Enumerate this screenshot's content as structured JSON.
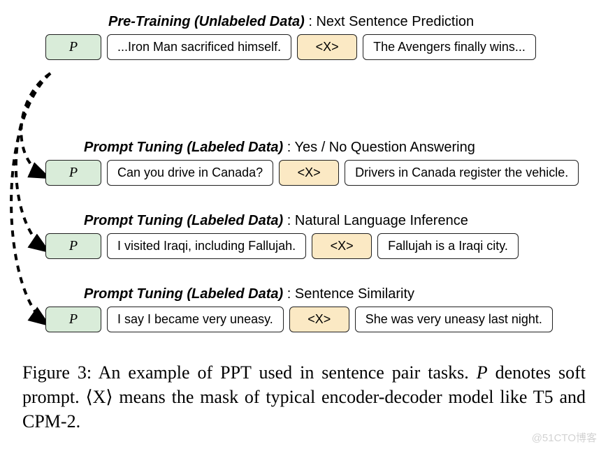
{
  "rows": [
    {
      "heading_bold": "Pre-Training (Unlabeled Data)",
      "heading_rest": " : Next Sentence Prediction",
      "p": "P",
      "left": "...Iron Man sacrificed himself.",
      "x": "<X>",
      "right": "The Avengers finally wins..."
    },
    {
      "heading_bold": "Prompt Tuning (Labeled Data)",
      "heading_rest": " : Yes / No Question Answering",
      "p": "P",
      "left": "Can you drive in Canada?",
      "x": "<X>",
      "right": "Drivers in Canada register the vehicle."
    },
    {
      "heading_bold": "Prompt Tuning (Labeled Data)",
      "heading_rest": " : Natural Language Inference",
      "p": "P",
      "left": "I visited Iraqi, including Fallujah.",
      "x": "<X>",
      "right": "Fallujah is a Iraqi city."
    },
    {
      "heading_bold": "Prompt Tuning (Labeled Data)",
      "heading_rest": " : Sentence Similarity",
      "p": "P",
      "left": "I say I became very uneasy.",
      "x": "<X>",
      "right": "She was very uneasy last night."
    }
  ],
  "caption_parts": {
    "pre": "Figure 3:  An example of PPT used in sentence pair tasks.  ",
    "p_var": "P",
    "mid": " denotes soft prompt. ⟨X⟩ means the mask of typical encoder-decoder model like T5 and CPM-2."
  },
  "watermark": "@51CTO博客"
}
